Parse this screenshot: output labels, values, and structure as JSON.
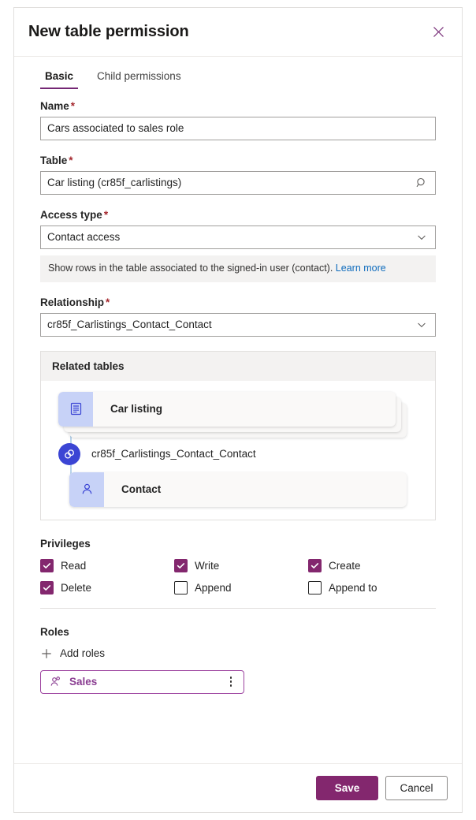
{
  "header": {
    "title": "New table permission",
    "close_icon": "close-icon"
  },
  "tabs": [
    {
      "label": "Basic",
      "active": true
    },
    {
      "label": "Child permissions",
      "active": false
    }
  ],
  "form": {
    "name": {
      "label": "Name",
      "required_mark": "*",
      "value": "Cars associated to sales role",
      "placeholder": ""
    },
    "table": {
      "label": "Table",
      "required_mark": "*",
      "value": "Car listing (cr85f_carlistings)",
      "placeholder": "",
      "icon": "search-icon"
    },
    "access_type": {
      "label": "Access type",
      "required_mark": "*",
      "value": "Contact access",
      "icon": "chevron-down-icon",
      "info_text": "Show rows in the table associated to the signed-in user (contact).",
      "info_link": "Learn more"
    },
    "relationship": {
      "label": "Relationship",
      "required_mark": "*",
      "value": "cr85f_Carlistings_Contact_Contact",
      "icon": "chevron-down-icon"
    }
  },
  "related_tables": {
    "title": "Related tables",
    "source_table": "Car listing",
    "source_icon": "table-icon",
    "relationship_name": "cr85f_Carlistings_Contact_Contact",
    "relationship_icon": "link-icon",
    "target_table": "Contact",
    "target_icon": "person-icon"
  },
  "privileges": {
    "title": "Privileges",
    "items": [
      {
        "label": "Read",
        "checked": true
      },
      {
        "label": "Write",
        "checked": true
      },
      {
        "label": "Create",
        "checked": true
      },
      {
        "label": "Delete",
        "checked": true
      },
      {
        "label": "Append",
        "checked": false
      },
      {
        "label": "Append to",
        "checked": false
      }
    ]
  },
  "roles": {
    "title": "Roles",
    "add_label": "Add roles",
    "add_icon": "plus-icon",
    "chips": [
      {
        "label": "Sales",
        "icon": "people-icon",
        "menu_icon": "more-vertical-icon"
      }
    ]
  },
  "footer": {
    "save_label": "Save",
    "cancel_label": "Cancel"
  },
  "colors": {
    "accent": "#83276e",
    "tab_underline": "#742774",
    "link": "#0f6cbd",
    "required": "#a4262c",
    "node_blue": "#3b45d4",
    "node_tile": "#c7d2f7",
    "role_border": "#9d44a0"
  }
}
